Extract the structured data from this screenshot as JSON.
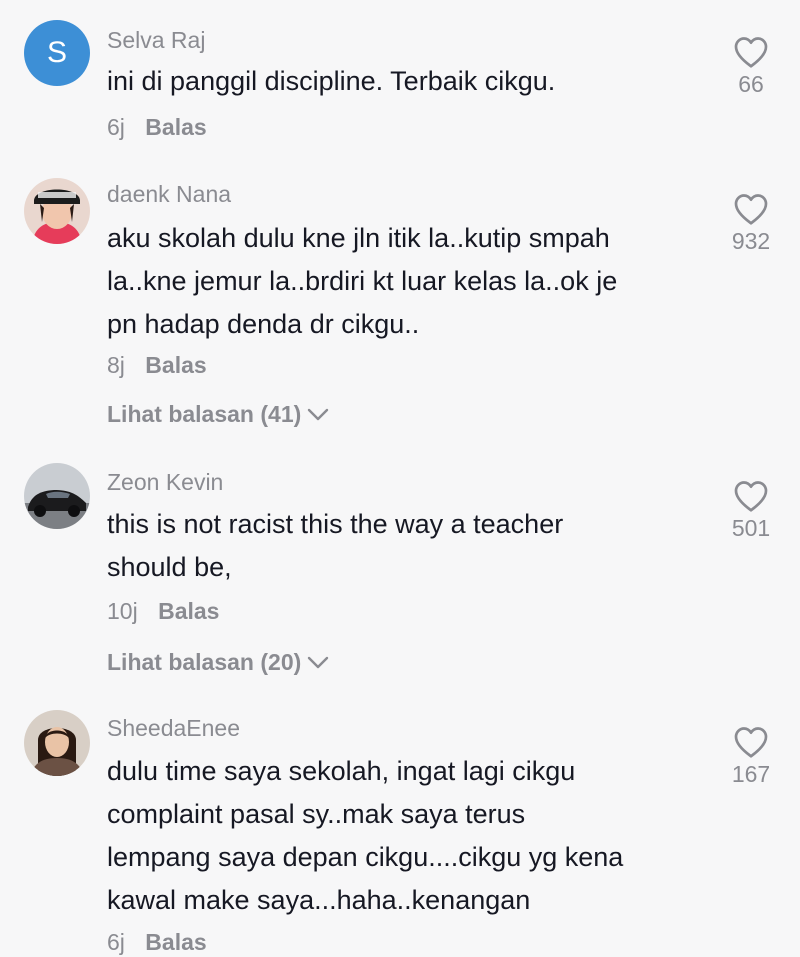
{
  "comments": [
    {
      "avatar_letter": "S",
      "username": "Selva Raj",
      "text_lines": [
        "ini di panggil discipline. Terbaik cikgu."
      ],
      "time": "6j",
      "reply_label": "Balas",
      "likes": "66"
    },
    {
      "username": "daenk Nana",
      "text_lines": [
        "aku skolah dulu kne jln itik la..kutip smpah",
        "la..kne jemur la..brdiri kt luar kelas la..ok je",
        "pn hadap denda dr cikgu.."
      ],
      "time": "8j",
      "reply_label": "Balas",
      "view_replies": "Lihat balasan (41)",
      "likes": "932"
    },
    {
      "username": "Zeon Kevin",
      "text_lines": [
        "this is not racist this the way a teacher",
        "should be,"
      ],
      "time": "10j",
      "reply_label": "Balas",
      "view_replies": "Lihat balasan (20)",
      "likes": "501"
    },
    {
      "username": "SheedaEnee",
      "text_lines": [
        "dulu time saya sekolah, ingat lagi cikgu",
        "complaint pasal sy..mak saya terus",
        "lempang saya depan cikgu....cikgu yg kena",
        "kawal make saya...haha..kenangan"
      ],
      "time": "6j",
      "reply_label": "Balas",
      "likes": "167"
    }
  ],
  "colors": {
    "meta": "#8a8b91",
    "text": "#161823",
    "avatar_s": "#3d8fd6"
  },
  "icons": {
    "like": "heart-outline-icon",
    "expand": "chevron-down-icon"
  }
}
